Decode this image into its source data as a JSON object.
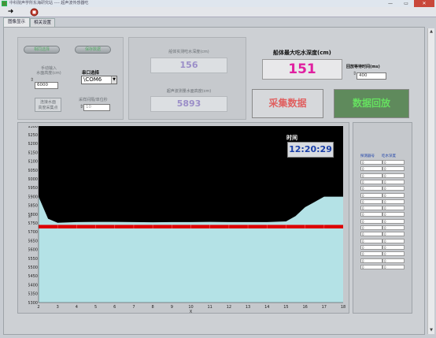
{
  "window": {
    "title": "中科院声学所东海研究站 ---- 超声波传感器吃",
    "min": "—",
    "max": "▭",
    "close": "✕"
  },
  "toolbar": {
    "run_icon": "arrow-right-icon",
    "stop_icon": "stop-icon"
  },
  "tabs": [
    {
      "label": "图像显示",
      "active": true
    },
    {
      "label": "相关设置",
      "active": false
    }
  ],
  "controls": {
    "led_button_1": "相同选择",
    "led_button_2": "保存数据",
    "water_depth_label": "手动输入\n水面高度(cm)",
    "water_depth_value": "6000",
    "port_label": "串口选择",
    "port_value": "\\COM6",
    "reverse_button_line1": "连接水面",
    "reverse_button_line2": "高度采集点",
    "sample_label": "采样间隔/单位秒",
    "sample_value": "10"
  },
  "readouts": {
    "draft_label": "船体实测吃水深度(cm)",
    "draft_value": "156",
    "water_label": "超声波测量水面高度(cm)",
    "water_value": "5893",
    "max_draft_label": "船体最大吃水深度(cm)",
    "max_draft_value": "151",
    "interval_label": "回放等待时间(ms)",
    "interval_value": "400"
  },
  "buttons": {
    "collect": "采集数据",
    "playback": "数据回放"
  },
  "colors": {
    "collect_text": "#e06060",
    "playback_text": "#66e060",
    "playback_bg": "#5f8a5c",
    "max_draft_text": "#e020a0",
    "time_text": "#1a3fa8",
    "chart_fill": "#b4e2e6",
    "chart_bg": "#000000",
    "red_band": "#dd0000"
  },
  "time": {
    "label": "时间",
    "value": "12:20:29"
  },
  "table": {
    "headers": [
      "探测器号",
      "吃水深度"
    ],
    "rows": 17
  },
  "chart_data": {
    "type": "area",
    "x": [
      2,
      2.5,
      3,
      4,
      5,
      6,
      7,
      8,
      9,
      10,
      11,
      12,
      13,
      14,
      15,
      15.5,
      16,
      16.5,
      17,
      18
    ],
    "y": [
      5900,
      5775,
      5752,
      5756,
      5757,
      5757,
      5756,
      5755,
      5756,
      5756,
      5757,
      5756,
      5756,
      5756,
      5760,
      5790,
      5840,
      5870,
      5900,
      5900
    ],
    "red_band": [
      5720,
      5740
    ],
    "xlim": [
      2,
      18
    ],
    "ylim": [
      5300,
      6300
    ],
    "xticks": [
      "2",
      "3",
      "4",
      "5",
      "6",
      "7",
      "8",
      "9",
      "10",
      "11",
      "12",
      "13",
      "14",
      "15",
      "16",
      "17",
      "18"
    ],
    "yticks": [
      "5300",
      "5350",
      "5400",
      "5450",
      "5500",
      "5550",
      "5600",
      "5650",
      "5700",
      "5750",
      "5800",
      "5850",
      "5900",
      "5950",
      "6000",
      "6050",
      "6100",
      "6150",
      "6200",
      "6250",
      "6300"
    ],
    "xlabel": "X",
    "ylabel": "Y"
  }
}
